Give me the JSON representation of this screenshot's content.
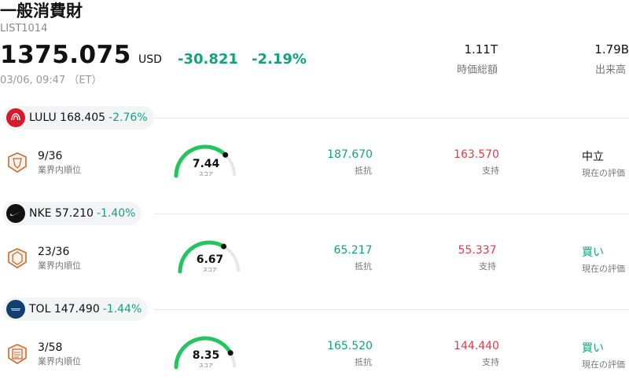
{
  "header": {
    "title": "一般消費財",
    "code": "LIST1014",
    "price": "1375.075",
    "currency": "USD",
    "change": "-30.821",
    "change_pct": "-2.19%",
    "time": "03/06, 09:47 （ET）",
    "market_cap_value": "1.11T",
    "market_cap_label": "時価総額",
    "volume_value": "1.79B",
    "volume_label": "出来高"
  },
  "colors": {
    "up_green": "#10a37f",
    "down_red": "#e5394a",
    "gauge_green": "#22c55e"
  },
  "stocks": [
    {
      "symbol": "LULU",
      "price": "168.405",
      "change_pct": "-2.76%",
      "logo_icon": "lululemon-logo-icon",
      "rank": "9/36",
      "rank_label": "業界内順位",
      "score": "7.44",
      "score_label": "スコア",
      "score_fraction": 0.744,
      "resistance": "187.670",
      "resistance_label": "抵抗",
      "support": "163.570",
      "support_label": "支持",
      "rating": "中立",
      "rating_label": "現在の評価"
    },
    {
      "symbol": "NKE",
      "price": "57.210",
      "change_pct": "-1.40%",
      "logo_icon": "nike-logo-icon",
      "rank": "23/36",
      "rank_label": "業界内順位",
      "score": "6.67",
      "score_label": "スコア",
      "score_fraction": 0.667,
      "resistance": "65.217",
      "resistance_label": "抵抗",
      "support": "55.337",
      "support_label": "支持",
      "rating": "買い",
      "rating_label": "現在の評価"
    },
    {
      "symbol": "TOL",
      "price": "147.490",
      "change_pct": "-1.44%",
      "logo_icon": "toll-brothers-logo-icon",
      "rank": "3/58",
      "rank_label": "業界内順位",
      "score": "8.35",
      "score_label": "スコア",
      "score_fraction": 0.835,
      "resistance": "165.520",
      "resistance_label": "抵抗",
      "support": "144.440",
      "support_label": "支持",
      "rating": "買い",
      "rating_label": "現在の評価"
    }
  ]
}
